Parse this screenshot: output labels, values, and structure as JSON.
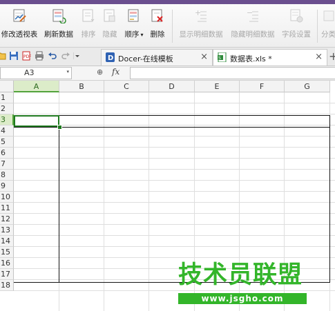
{
  "ribbon": {
    "buttons": [
      {
        "label": "修改透视表",
        "icon": "edit-pivot-icon",
        "enabled": true
      },
      {
        "label": "刷新数据",
        "icon": "refresh-data-icon",
        "enabled": true
      },
      {
        "label": "排序",
        "icon": "sort-icon",
        "enabled": false
      },
      {
        "label": "隐藏",
        "icon": "hide-icon",
        "enabled": false
      },
      {
        "label": "顺序",
        "icon": "order-icon",
        "enabled": true,
        "dropdown": "▾"
      },
      {
        "label": "删除",
        "icon": "delete-icon",
        "enabled": true
      },
      {
        "label": "显示明细数据",
        "icon": "show-detail-icon",
        "enabled": false
      },
      {
        "label": "隐藏明细数据",
        "icon": "hide-detail-icon",
        "enabled": false
      },
      {
        "label": "字段设置",
        "icon": "field-settings-icon",
        "enabled": false
      },
      {
        "label": "分类",
        "icon": "classify-icon",
        "enabled": false
      }
    ]
  },
  "quickaccess": [
    "folder-open-icon",
    "save-icon",
    "pdf-icon",
    "print-icon",
    "undo-icon",
    "redo-icon",
    "customize-dropdown-icon"
  ],
  "tabs": [
    {
      "label": "Docer-在线模板",
      "icon": "docer-icon",
      "close": "×",
      "active": false
    },
    {
      "label": "数据表.xls *",
      "icon": "xls-file-icon",
      "close": "×",
      "active": true
    }
  ],
  "new_tab": "+",
  "formula_bar": {
    "name_box": "A3",
    "name_dropdown": "▾",
    "zoom_icon": "⊕",
    "fx": "fx",
    "formula": ""
  },
  "sheet": {
    "columns": [
      "A",
      "B",
      "C",
      "D",
      "E",
      "F",
      "G"
    ],
    "rows": [
      "1",
      "2",
      "3",
      "4",
      "5",
      "6",
      "7",
      "8",
      "9",
      "10",
      "11",
      "12",
      "13",
      "14",
      "15",
      "16",
      "17",
      "18"
    ],
    "active_cell": "A3",
    "active_column": "A",
    "active_row": "3",
    "selection_color": "#1f7a1f"
  },
  "watermark": {
    "logo_text": "技术员联盟",
    "url": "www.jsgho.com",
    "color": "#33b52a"
  }
}
